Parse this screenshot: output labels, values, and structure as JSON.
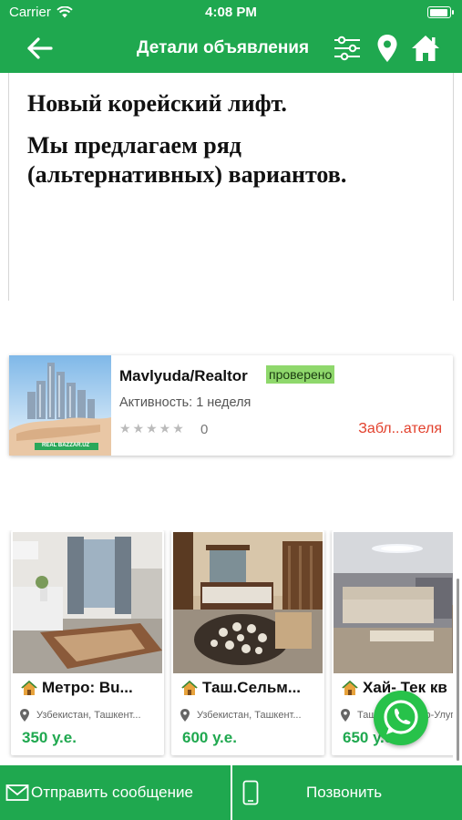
{
  "status_bar": {
    "carrier": "Carrier",
    "time": "4:08 PM"
  },
  "header": {
    "title": "Детали объявления",
    "icons": [
      "back-arrow-icon",
      "filter-sliders-icon",
      "location-pin-icon",
      "home-icon"
    ]
  },
  "description": {
    "line1": "Новый корейский лифт.",
    "line2": "Мы предлагаем ряд (альтернативных) вариантов."
  },
  "agent": {
    "name": "Mavlyuda/Realtor",
    "badge": "проверено",
    "activity": "Активность: 1 неделя",
    "stars": "★★★★★",
    "rating": "0",
    "rating_stars_filled": 0,
    "block_link": "Забл...ателя",
    "photo_caption": "REAL BAZZAR.UZ"
  },
  "listings": [
    {
      "title": "Метро: Bu...",
      "location": "Узбекистан, Ташкент...",
      "price": "350 у.е."
    },
    {
      "title": "Таш.Сельм...",
      "location": "Узбекистан, Ташкент...",
      "price": "600 у.е."
    },
    {
      "title": "Хай- Тек кв",
      "location": "Ташкент, Мирзо-Улугбе",
      "price": "650 у.е."
    }
  ],
  "bottom_bar": {
    "message_label": "Отправить сообщение",
    "call_label": "Позвонить"
  },
  "colors": {
    "brand_green": "#1fa84f",
    "badge_green": "#8fd86c",
    "block_red": "#e2402c",
    "whatsapp": "#27c24a"
  }
}
